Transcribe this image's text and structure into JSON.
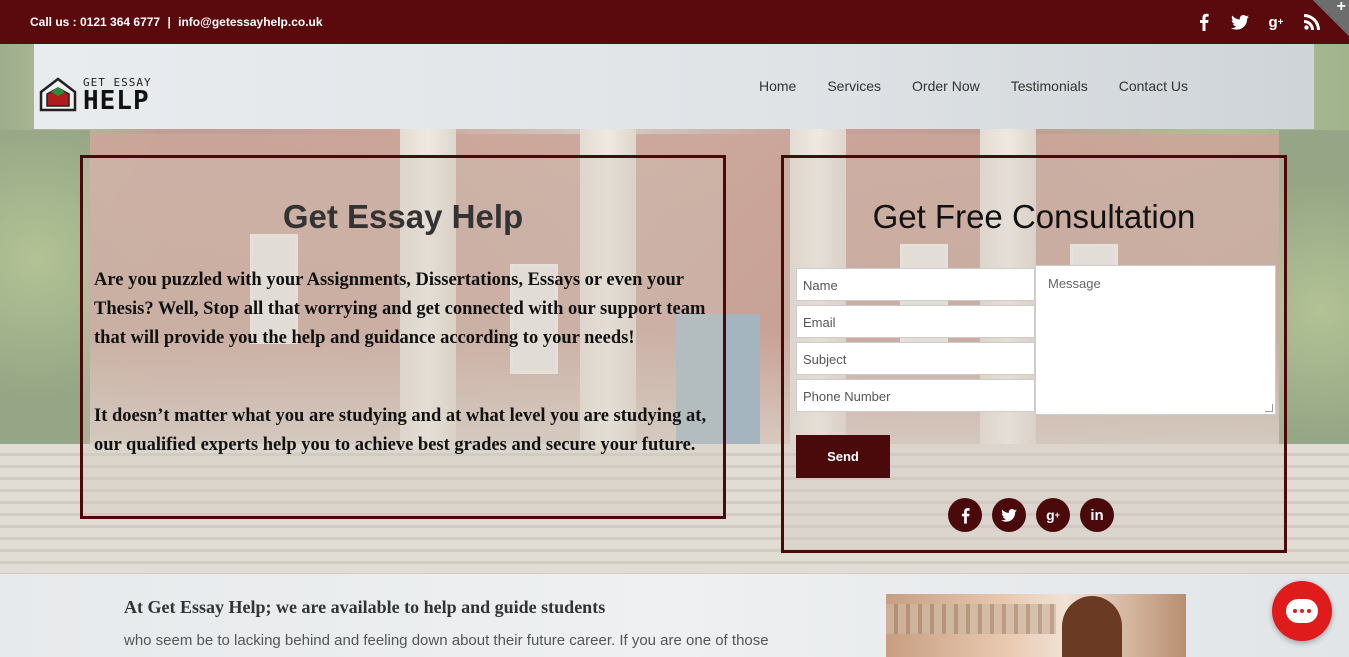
{
  "topbar": {
    "phone_text": "Call us : 0121 364 6777",
    "separator": "|",
    "email_text": "info@getessayhelp.co.uk",
    "social": [
      {
        "icon": "facebook-icon",
        "glyph": "f"
      },
      {
        "icon": "twitter-icon",
        "glyph": "🐦"
      },
      {
        "icon": "google-plus-icon",
        "glyph": "g+"
      },
      {
        "icon": "rss-icon",
        "glyph": "))"
      }
    ],
    "corner_glyph": "+"
  },
  "logo": {
    "line1": "GET ESSAY",
    "line2": "HELP"
  },
  "nav": {
    "items": [
      "Home",
      "Services",
      "Order Now",
      "Testimonials",
      "Contact Us"
    ]
  },
  "intro": {
    "title": "Get Essay Help",
    "paragraph1": "Are you puzzled with your Assignments, Dissertations, Essays or even your Thesis? Well, Stop all that worrying and get connected with our support team that will provide you the help and guidance according to your needs!",
    "paragraph2": "It doesn’t matter what you are studying and at what level you are studying at, our qualified experts help you to achieve best grades and secure your future."
  },
  "consultation": {
    "title": "Get Free Consultation",
    "name_placeholder": "Name",
    "email_placeholder": "Email",
    "subject_placeholder": "Subject",
    "phone_placeholder": "Phone Number",
    "message_placeholder": "Message",
    "send_label": "Send",
    "social": [
      {
        "icon": "facebook-icon",
        "glyph": "f"
      },
      {
        "icon": "twitter-icon",
        "glyph": "🐦"
      },
      {
        "icon": "google-plus-icon",
        "glyph": "g+"
      },
      {
        "icon": "linkedin-icon",
        "glyph": "in"
      }
    ]
  },
  "about": {
    "heading": "At Get Essay Help; we are available to help and guide students",
    "text": "who seem be to lacking behind and feeling down about their future career. If you are one of those"
  },
  "colors": {
    "brand": "#5a0a0c",
    "chat_button": "#e01b1b"
  }
}
